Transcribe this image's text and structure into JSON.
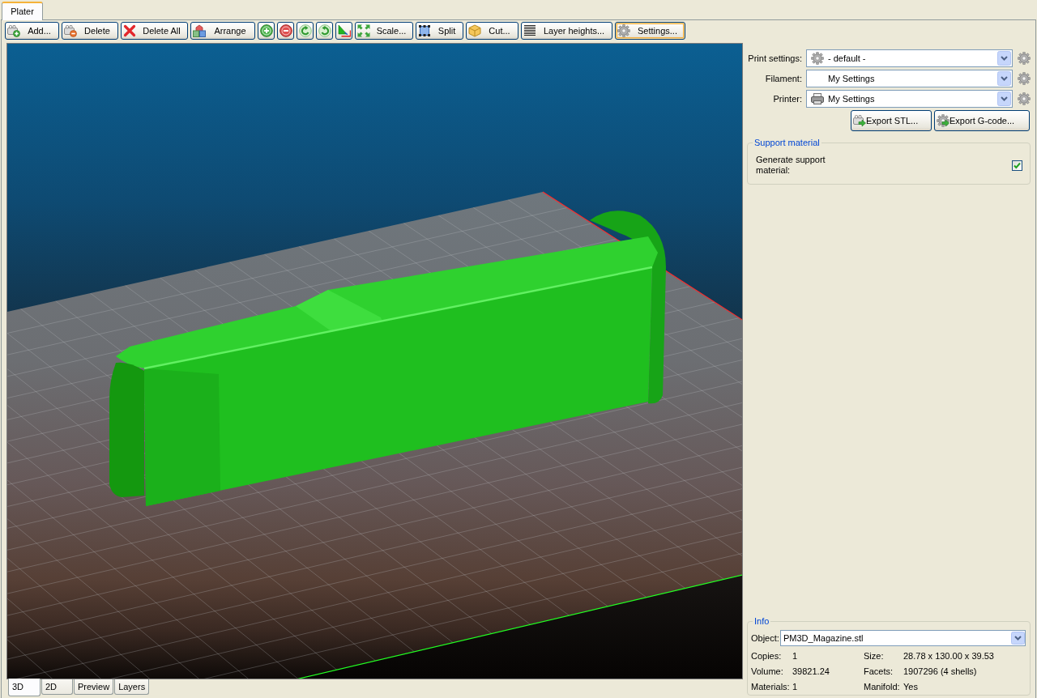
{
  "tabs": [
    {
      "label": "Plater",
      "selected": true
    }
  ],
  "toolbar": [
    {
      "kind": "labeled",
      "label": "Add...",
      "focused": false
    },
    {
      "kind": "labeled",
      "label": "Delete",
      "focused": false
    },
    {
      "kind": "labeled",
      "label": "Delete All",
      "focused": false
    },
    {
      "kind": "labeled",
      "label": "Arrange",
      "focused": false
    },
    {
      "kind": "icon",
      "focused": false
    },
    {
      "kind": "icon",
      "focused": false
    },
    {
      "kind": "icon",
      "focused": false
    },
    {
      "kind": "icon",
      "focused": false
    },
    {
      "kind": "icon",
      "focused": false
    },
    {
      "kind": "labeled",
      "label": "Scale...",
      "focused": false
    },
    {
      "kind": "labeled",
      "label": "Split",
      "focused": false
    },
    {
      "kind": "labeled",
      "label": "Cut...",
      "focused": false
    },
    {
      "kind": "labeled",
      "label": "Layer heights...",
      "focused": false
    },
    {
      "kind": "labeled",
      "label": "Settings...",
      "focused": true
    }
  ],
  "presets": [
    {
      "kind": "print",
      "label": "Print settings:",
      "value": "- default -"
    },
    {
      "kind": "filament",
      "label": "Filament:",
      "value": "My Settings"
    },
    {
      "kind": "printer",
      "label": "Printer:",
      "value": "My Settings"
    }
  ],
  "export_buttons": [
    {
      "label": "Export STL..."
    },
    {
      "label": "Export G-code..."
    }
  ],
  "support": {
    "title": "Support material",
    "options": [
      {
        "label": "Generate support material:",
        "checked": true
      }
    ]
  },
  "info": {
    "title": "Info",
    "object": {
      "label": "Object:",
      "value": "PM3D_Magazine.stl"
    },
    "stats": [
      {
        "label": "Copies:",
        "value": "1"
      },
      {
        "label": "Size:",
        "value": "28.78 x 130.00 x 39.53"
      },
      {
        "label": "Volume:",
        "value": "39821.24"
      },
      {
        "label": "Facets:",
        "value": "1907296 (4 shells)"
      },
      {
        "label": "Materials:",
        "value": "1"
      },
      {
        "label": "Manifold:",
        "value": "Yes"
      }
    ]
  },
  "view_tabs": [
    {
      "label": "3D",
      "selected": true
    },
    {
      "label": "2D",
      "selected": false
    },
    {
      "label": "Preview",
      "selected": false
    },
    {
      "label": "Layers",
      "selected": false
    }
  ]
}
